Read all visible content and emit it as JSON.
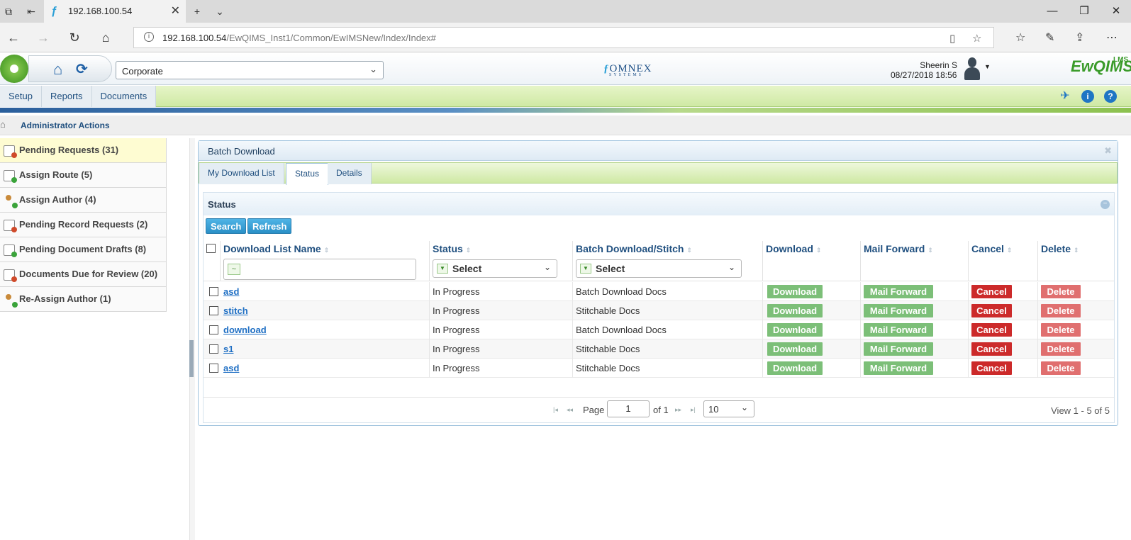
{
  "browser": {
    "tab_title": "192.168.100.54",
    "url_host": "192.168.100.54",
    "url_path": "/EwQIMS_Inst1/Common/EwIMSNew/Index/Index#"
  },
  "header": {
    "site_select": "Corporate",
    "omnex_logo": "OMNEX",
    "omnex_sub": "SYSTEMS",
    "user_name": "Sheerin S",
    "datetime": "08/27/2018 18:56",
    "product_logo": "EwQIMS",
    "product_sup": "LMS"
  },
  "menu": {
    "items": [
      "Setup",
      "Reports",
      "Documents"
    ]
  },
  "breadcrumb": {
    "text": "Administrator Actions"
  },
  "sidebar": {
    "items": [
      {
        "label": "Pending Requests (31)"
      },
      {
        "label": "Assign Route (5)"
      },
      {
        "label": "Assign Author (4)"
      },
      {
        "label": "Pending Record Requests (2)"
      },
      {
        "label": "Pending Document Drafts (8)"
      },
      {
        "label": "Documents Due for Review (20)"
      },
      {
        "label": "Re-Assign Author (1)"
      }
    ]
  },
  "panel": {
    "title": "Batch Download",
    "tabs": [
      "My Download List",
      "Status",
      "Details"
    ],
    "active_tab": "Status",
    "section_title": "Status",
    "search_label": "Search",
    "refresh_label": "Refresh"
  },
  "grid": {
    "columns": [
      "Download List Name",
      "Status",
      "Batch Download/Stitch",
      "Download",
      "Mail Forward",
      "Cancel",
      "Delete"
    ],
    "filter_status": "Select",
    "filter_batch": "Select",
    "download_label": "Download",
    "mail_label": "Mail Forward",
    "cancel_label": "Cancel",
    "delete_label": "Delete",
    "rows": [
      {
        "name": "asd",
        "status": "In Progress",
        "type": "Batch Download Docs"
      },
      {
        "name": "stitch",
        "status": "In Progress",
        "type": "Stitchable Docs"
      },
      {
        "name": "download",
        "status": "In Progress",
        "type": "Batch Download Docs"
      },
      {
        "name": "s1",
        "status": "In Progress",
        "type": "Stitchable Docs"
      },
      {
        "name": "asd",
        "status": "In Progress",
        "type": "Stitchable Docs"
      }
    ]
  },
  "pager": {
    "page_label": "Page",
    "page_value": "1",
    "of_label": "of 1",
    "page_size": "10",
    "view_text": "View 1 - 5 of 5"
  },
  "colors": {
    "accent_green": "#7cbf78",
    "cancel_red": "#cc2a2a",
    "delete_pink": "#e06f6f",
    "link_blue": "#1f6fc4"
  }
}
